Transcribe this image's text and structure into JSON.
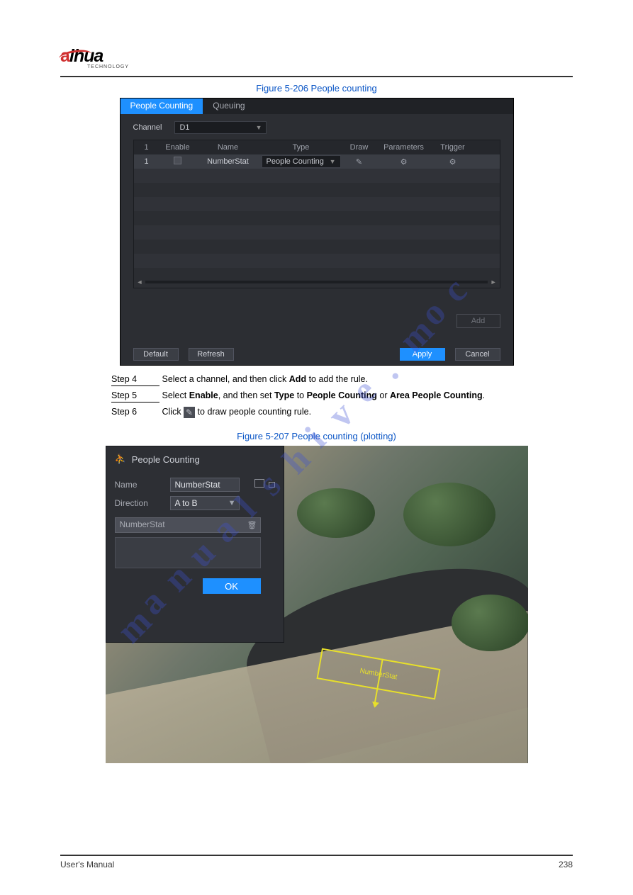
{
  "logo": {
    "brand_prefix": "a",
    "brand_rest": "lhua",
    "sub": "TECHNOLOGY"
  },
  "figure1": {
    "label": "Figure 5-206 People counting",
    "tabs": {
      "active": "People Counting",
      "other": "Queuing"
    },
    "channel_label": "Channel",
    "channel_value": "D1",
    "columns": {
      "c1": "1",
      "c2": "Enable",
      "c3": "Name",
      "c4": "Type",
      "c5": "Draw",
      "c6": "Parameters",
      "c7": "Trigger"
    },
    "row1": {
      "idx": "1",
      "name": "NumberStat",
      "type": "People Counting"
    },
    "add": "Add",
    "buttons": {
      "default": "Default",
      "refresh": "Refresh",
      "apply": "Apply",
      "cancel": "Cancel"
    }
  },
  "steps": {
    "s4": "Step 4",
    "s4_text": "Select a channel, and then click",
    "s4_text2": "to add the rule.",
    "s5": "Step 5",
    "s5_text": "Select",
    "s5_bold": "Enable",
    "s5_text2": ", and then set",
    "s5_bold2": "Type",
    "s5_text3": "to",
    "s5_bold3": "People Counting",
    "s5_or": "or",
    "s5_bold4": "Area People Counting",
    "s5_end": ".",
    "s6": "Step 6",
    "s6_text": "Click",
    "s6_text2": "to draw people counting rule."
  },
  "figure2": {
    "label": "Figure 5-207 People counting (plotting)",
    "title": "People Counting",
    "name_lbl": "Name",
    "name_val": "NumberStat",
    "dir_lbl": "Direction",
    "dir_val": "A to B",
    "list_val": "NumberStat",
    "ok": "OK",
    "zone_label": "NumberStat"
  },
  "watermark": "manualshive.com",
  "footer": {
    "left": "User's Manual",
    "right": "238"
  }
}
